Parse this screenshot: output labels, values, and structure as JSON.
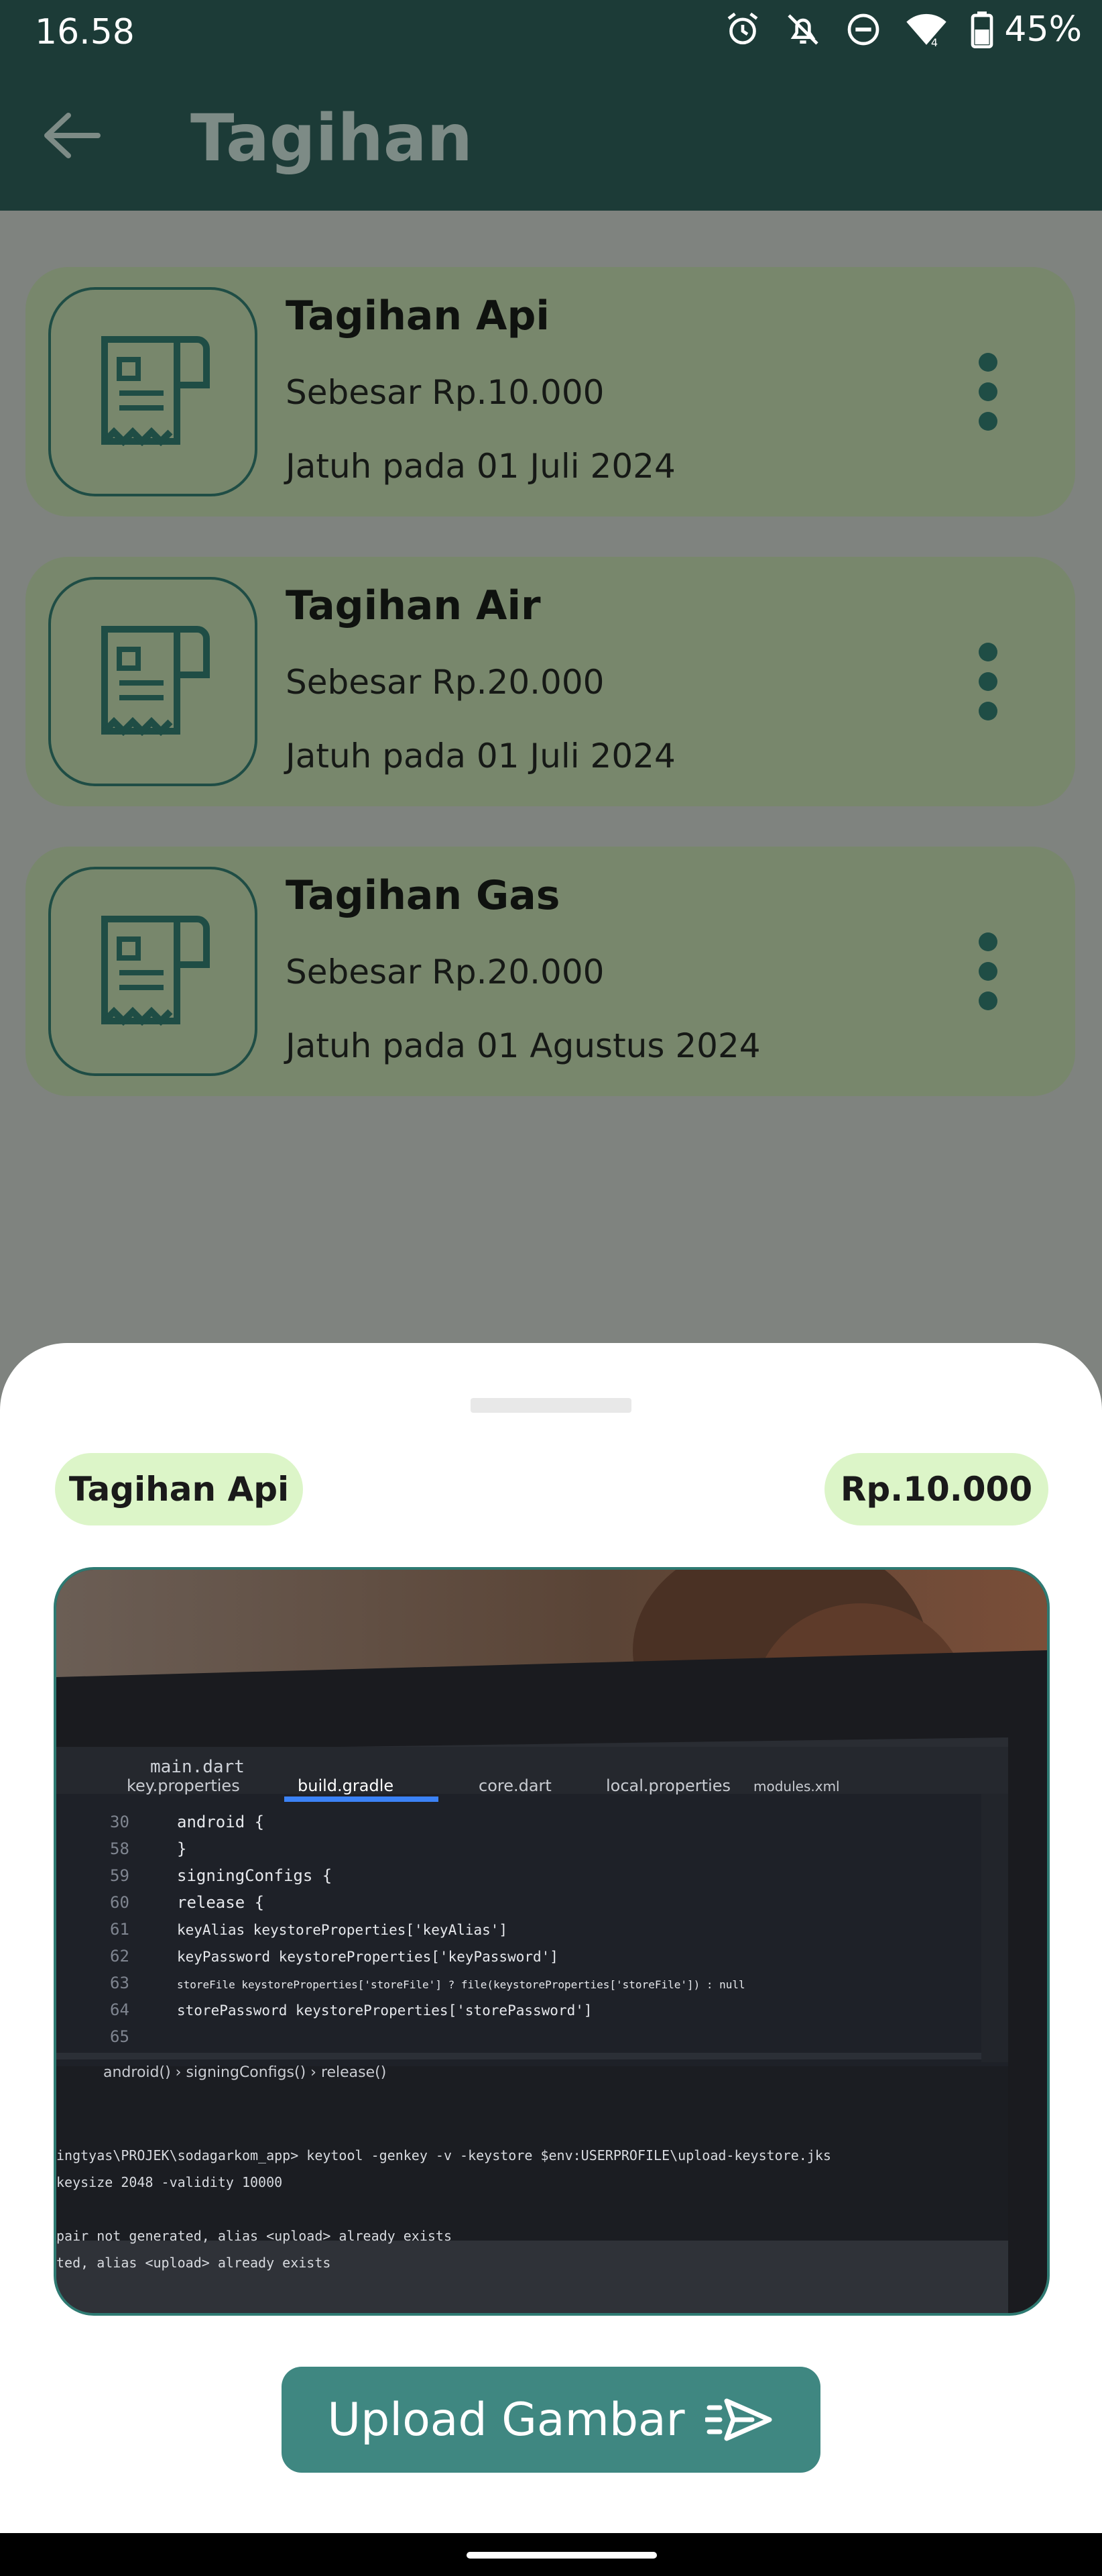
{
  "status_bar": {
    "time": "16.58",
    "battery": "45%",
    "icons": [
      "alarm-icon",
      "notifications-off-icon",
      "do-not-disturb-icon",
      "wifi-icon",
      "battery-icon"
    ]
  },
  "app_bar": {
    "title": "Tagihan",
    "back_icon": "arrow-left-icon"
  },
  "bills": [
    {
      "title": "Tagihan Api",
      "amount": "Sebesar Rp.10.000",
      "due": "Jatuh pada 01 Juli 2024"
    },
    {
      "title": "Tagihan Air",
      "amount": "Sebesar Rp.20.000",
      "due": "Jatuh pada 01 Juli 2024"
    },
    {
      "title": "Tagihan Gas",
      "amount": "Sebesar Rp.20.000",
      "due": "Jatuh pada 01 Agustus 2024"
    }
  ],
  "sheet": {
    "bill_name": "Tagihan Api",
    "bill_amount": "Rp.10.000",
    "photo": {
      "tabs": [
        "key.properties",
        "build.gradle",
        "core.dart",
        "local.properties",
        "modules.xml"
      ],
      "window_title": "main.dart",
      "code_lines": [
        {
          "no": "30",
          "text": "android {"
        },
        {
          "no": "58",
          "text": "    }"
        },
        {
          "no": "59",
          "text": "    signingConfigs {"
        },
        {
          "no": "60",
          "text": "        release {"
        },
        {
          "no": "61",
          "text": "            keyAlias keystoreProperties['keyAlias']"
        },
        {
          "no": "62",
          "text": "            keyPassword keystoreProperties['keyPassword']"
        },
        {
          "no": "63",
          "text": "            storeFile keystoreProperties['storeFile'] ? file(keystoreProperties['storeFile']) : null"
        },
        {
          "no": "64",
          "text": "            storePassword keystoreProperties['storePassword']"
        },
        {
          "no": "65",
          "text": ""
        }
      ],
      "breadcrumb": "android()  ›  signingConfigs()  ›  release()",
      "terminal_lines": [
        "ingtyas\\PROJEK\\sodagarkom_app> keytool -genkey -v -keystore $env:USERPROFILE\\upload-keystore.jks",
        "keysize 2048 -validity 10000",
        "pair not generated, alias <upload> already exists",
        "ted, alias <upload> already exists"
      ]
    },
    "upload_label": "Upload Gambar",
    "upload_icon": "send-icon"
  },
  "colors": {
    "accent": "#3f8781",
    "chip": "#dcf5c8",
    "card": "#78876c",
    "app_bar": "#1c3b37",
    "scrim": "#7f837f"
  }
}
